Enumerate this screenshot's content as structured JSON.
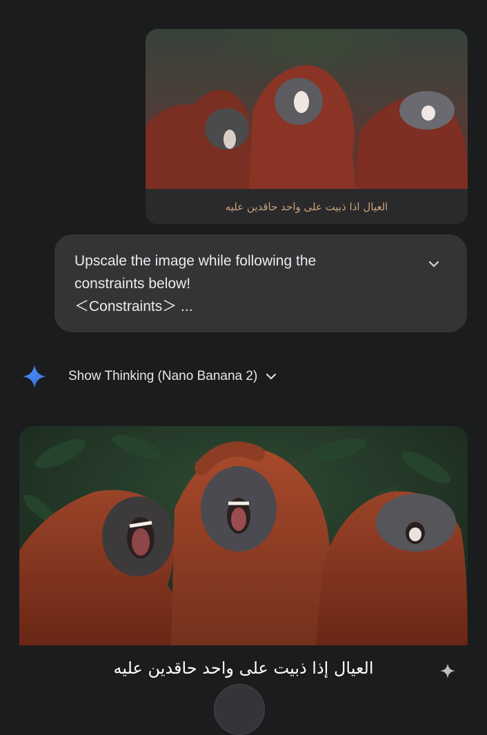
{
  "uploaded_image": {
    "caption": "العيال اذا ذبيت على واحد حاقدين عليه"
  },
  "prompt": {
    "lines": [
      "Upscale the image while following the",
      "constraints below!",
      "＜Constraints＞  ..."
    ],
    "expand_icon": "chevron-down-icon"
  },
  "thinking": {
    "label": "Show Thinking (Nano Banana 2)",
    "icon": "sparkle-icon",
    "accent": "#4a8cf7"
  },
  "generated_image": {
    "caption": "العيال إذا ذبيت على واحد حاقدين عليه",
    "icon": "sparkle-icon"
  },
  "colors": {
    "background": "#1b1c1e",
    "bubble": "#333436",
    "orangutan_fur": "#8a3a22",
    "foliage": "#233a28"
  }
}
